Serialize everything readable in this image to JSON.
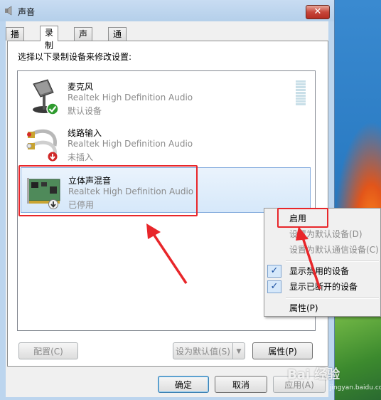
{
  "window": {
    "title": "声音",
    "close_glyph": "✕"
  },
  "tabs": [
    {
      "label": "播放",
      "active": false
    },
    {
      "label": "录制",
      "active": true
    },
    {
      "label": "声音",
      "active": false
    },
    {
      "label": "通信",
      "active": false
    }
  ],
  "instruction": "选择以下录制设备来修改设置:",
  "devices": [
    {
      "name": "麦克风",
      "description": "Realtek High Definition Audio",
      "status": "默认设备",
      "icon": "microphone-icon",
      "badge": "green-check-badge"
    },
    {
      "name": "线路输入",
      "description": "Realtek High Definition Audio",
      "status": "未插入",
      "icon": "line-in-cable-icon",
      "badge": "red-down-arrow-badge"
    },
    {
      "name": "立体声混音",
      "description": "Realtek High Definition Audio",
      "status": "已停用",
      "icon": "sound-card-icon",
      "badge": "gray-down-arrow-badge",
      "selected": true
    }
  ],
  "buttons": {
    "configure": "配置(C)",
    "set_default": "设为默认值(S)",
    "properties": "属性(P)",
    "ok": "确定",
    "cancel": "取消",
    "apply": "应用(A)"
  },
  "context_menu": {
    "items": [
      {
        "label": "启用",
        "enabled": true,
        "checked": false
      },
      {
        "label": "设置为默认设备(D)",
        "enabled": false,
        "checked": false
      },
      {
        "label": "设置为默认通信设备(C)",
        "enabled": false,
        "checked": false
      },
      {
        "label": "显示禁用的设备",
        "enabled": true,
        "checked": true
      },
      {
        "label": "显示已断开的设备",
        "enabled": true,
        "checked": true
      },
      {
        "label": "属性(P)",
        "enabled": true,
        "checked": false
      }
    ],
    "check_glyph": "✓"
  },
  "watermark": {
    "text": "Bai 经验",
    "sub": "jingyan.baidu.com"
  },
  "colors": {
    "annotation_red": "#e8262a",
    "selection": "#d6e8fa"
  }
}
